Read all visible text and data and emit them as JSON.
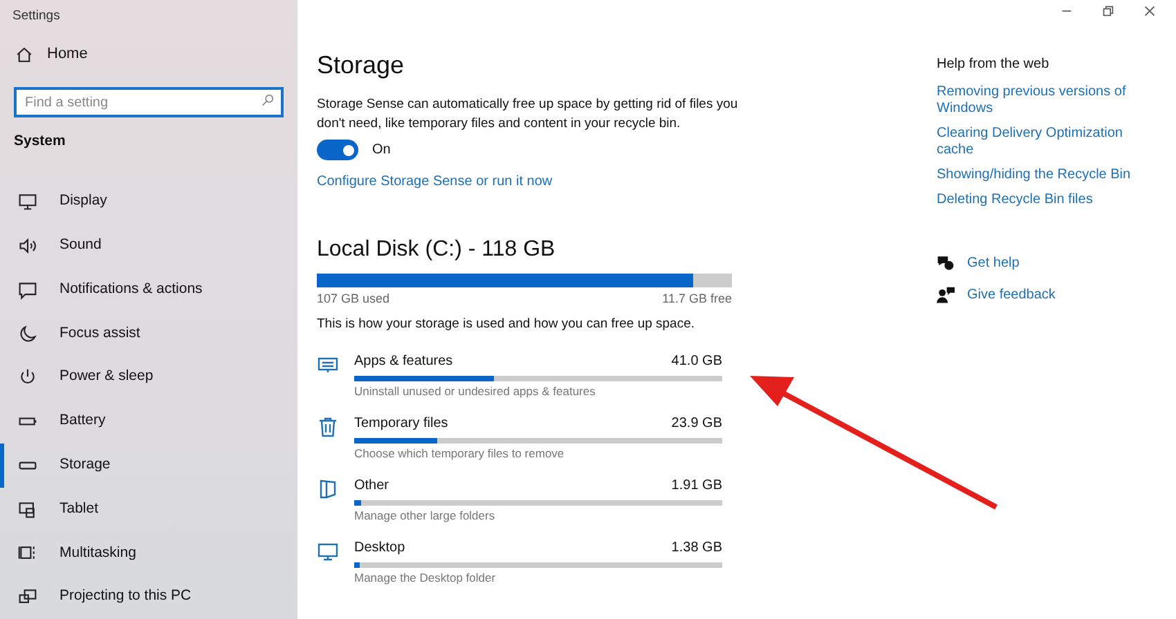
{
  "window": {
    "title": "Settings"
  },
  "sidebar": {
    "home": "Home",
    "search": {
      "placeholder": "Find a setting"
    },
    "section": "System",
    "items": [
      {
        "label": "Display",
        "kind": "display",
        "selected": false
      },
      {
        "label": "Sound",
        "kind": "sound",
        "selected": false
      },
      {
        "label": "Notifications & actions",
        "kind": "notifications",
        "selected": false
      },
      {
        "label": "Focus assist",
        "kind": "focus",
        "selected": false
      },
      {
        "label": "Power & sleep",
        "kind": "power",
        "selected": false
      },
      {
        "label": "Battery",
        "kind": "battery",
        "selected": false
      },
      {
        "label": "Storage",
        "kind": "storage",
        "selected": true
      },
      {
        "label": "Tablet",
        "kind": "tablet",
        "selected": false
      },
      {
        "label": "Multitasking",
        "kind": "multitasking",
        "selected": false
      },
      {
        "label": "Projecting to this PC",
        "kind": "projecting",
        "selected": false
      }
    ]
  },
  "page": {
    "title": "Storage",
    "description": "Storage Sense can automatically free up space by getting rid of files you don't need, like temporary files and content in your recycle bin.",
    "toggle": {
      "on": true,
      "label": "On"
    },
    "link": "Configure Storage Sense or run it now",
    "disk": {
      "title": "Local Disk (C:) - 118 GB",
      "level": 0.905,
      "used": "107 GB used",
      "free": "11.7 GB free",
      "note": "This is how your storage is used and how you can free up space."
    },
    "categories": [
      {
        "kind": "apps",
        "name": "Apps & features",
        "size": "41.0 GB",
        "level": 0.38,
        "description": "Uninstall unused or undesired apps & features"
      },
      {
        "kind": "temp",
        "name": "Temporary files",
        "size": "23.9 GB",
        "level": 0.225,
        "description": "Choose which temporary files to remove"
      },
      {
        "kind": "other",
        "name": "Other",
        "size": "1.91 GB",
        "level": 0.02,
        "description": "Manage other large folders"
      },
      {
        "kind": "desktop",
        "name": "Desktop",
        "size": "1.38 GB",
        "level": 0.015,
        "description": "Manage the Desktop folder"
      }
    ]
  },
  "help": {
    "title": "Help from the web",
    "links": [
      "Removing previous versions of Windows",
      "Clearing Delivery Optimization cache",
      "Showing/hiding the Recycle Bin",
      "Deleting Recycle Bin files"
    ],
    "actions": [
      {
        "kind": "help",
        "label": "Get help"
      },
      {
        "kind": "feedback",
        "label": "Give feedback"
      }
    ]
  }
}
